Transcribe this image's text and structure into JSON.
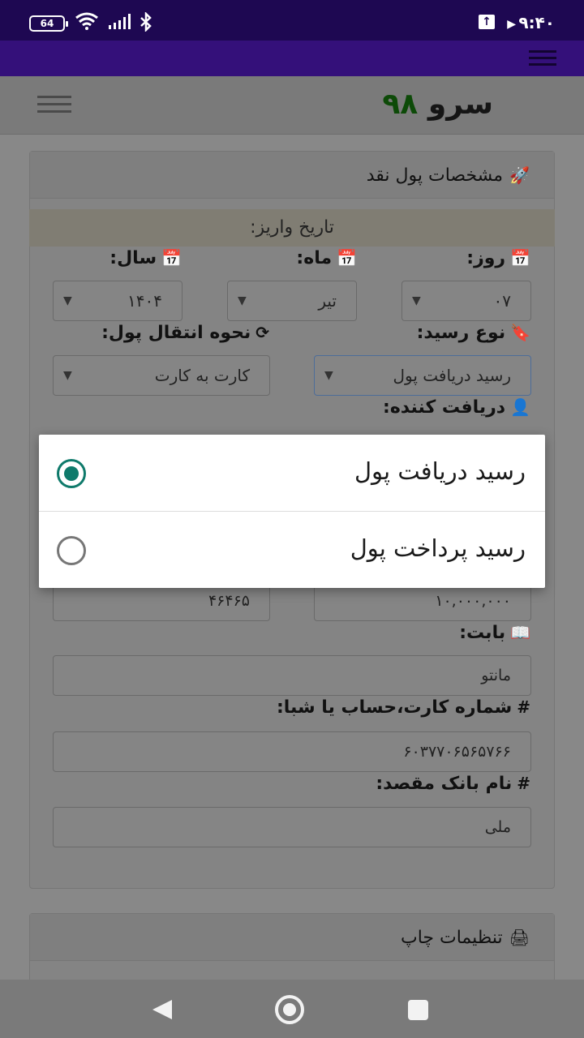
{
  "status_bar": {
    "battery": "64",
    "time": "۹:۴۰",
    "upload_icon": "↑"
  },
  "app": {
    "logo_num": "۹۸",
    "logo_text": "سرو"
  },
  "cash_card": {
    "header_icon": "rocket-icon",
    "title": "مشخصات پول نقد",
    "date_label": "تاریخ واریز:",
    "day_label": "روز:",
    "month_label": "ماه:",
    "year_label": "سال:",
    "day_value": "۰۷",
    "month_value": "تیر",
    "year_value": "۱۴۰۴",
    "receipt_type_label": "نوع رسید:",
    "transfer_method_label": "نحوه انتقال پول:",
    "receipt_type_value": "رسید دریافت پول",
    "transfer_method_value": "کارت به کارت",
    "receiver_label": "دریافت کننده:",
    "amount_value": "۱۰,۰۰۰,۰۰۰",
    "tracking_value": "۴۶۴۶۵",
    "for_label": "بابت:",
    "for_value": "مانتو",
    "card_number_label": "شماره کارت،حساب یا شبا:",
    "card_number_value": "۶۰۳۷۷۰۶۵۶۵۷۶۶",
    "bank_label": "نام بانک مقصد:",
    "bank_value": "ملی"
  },
  "print_card": {
    "title": "تنظیمات چاپ",
    "header_icon": "printer-icon"
  },
  "dialog": {
    "options": [
      {
        "label": "رسید دریافت پول",
        "checked": true
      },
      {
        "label": "رسید پرداخت پول",
        "checked": false
      }
    ],
    "accent": "#0f7a6b"
  },
  "colors": {
    "status_bar": "#1e0852",
    "purple_nav": "#34107a"
  }
}
